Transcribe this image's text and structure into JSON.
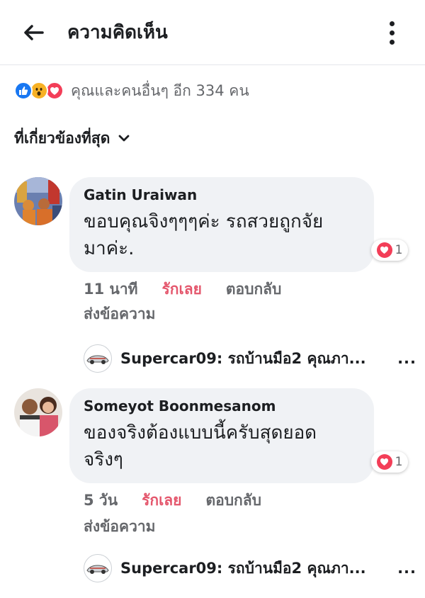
{
  "header": {
    "title": "ความคิดเห็น",
    "back_icon": "arrow-left-icon",
    "more_icon": "more-vertical-icon"
  },
  "reactions": {
    "icons": [
      "like-icon",
      "wow-icon",
      "love-icon"
    ],
    "summary": "คุณและคนอื่นๆ อีก 334 คน"
  },
  "sort": {
    "label": "ที่เกี่ยวข้องที่สุด",
    "icon": "chevron-down-icon"
  },
  "comments": [
    {
      "author": "Gatin Uraiwan",
      "text_line1": "ขอบคุณจิงๆๆๆค่ะ รถสวยถูกจัย",
      "text_line2": "มาค่ะ.",
      "reaction_count": "1",
      "time": "11 นาที",
      "like_label": "รักเลย",
      "reply_label": "ตอบกลับ",
      "send_label": "ส่งข้อความ",
      "page_reply_text": "Supercar09: รถบ้านมือ2 คุณภา...",
      "page_reply_more": "..."
    },
    {
      "author": "Someyot Boonmesanom",
      "text_line1": "ของจริงต้องแบบนี้ครับสุดยอด",
      "text_line2": "จริงๆ",
      "reaction_count": "1",
      "time": "5 วัน",
      "like_label": "รักเลย",
      "reply_label": "ตอบกลับ",
      "send_label": "ส่งข้อความ",
      "page_reply_text": "Supercar09: รถบ้านมือ2 คุณภา...",
      "page_reply_more": "..."
    }
  ],
  "colors": {
    "like_blue": "#1877f2",
    "love_red": "#f33e58",
    "wow_yellow": "#f7b125",
    "action_pink": "#e4566c",
    "bubble_gray": "#f0f2f5",
    "muted_text": "#65676b"
  }
}
